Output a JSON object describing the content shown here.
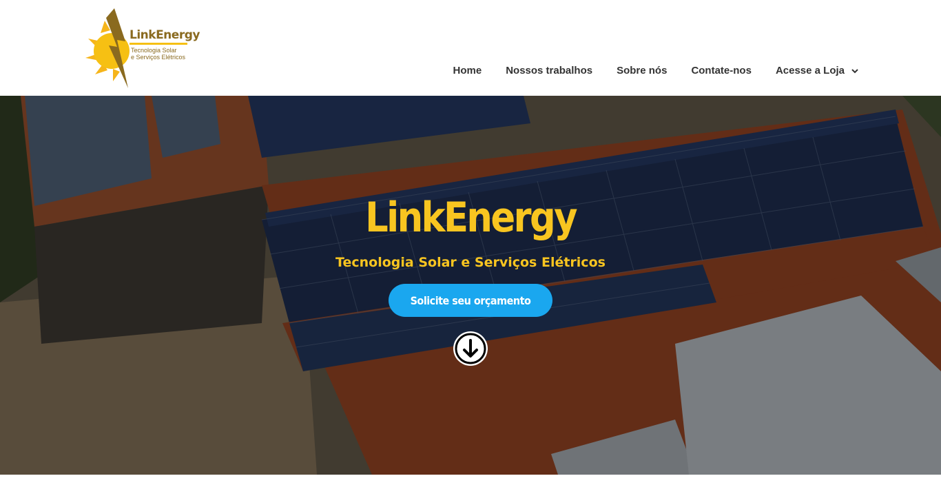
{
  "brand": {
    "name": "LinkEnergy",
    "tagline_line1": "Tecnologia Solar",
    "tagline_line2": "e Serviços Elétricos",
    "icon": "sun-lightning-logo"
  },
  "nav": {
    "items": [
      {
        "label": "Home"
      },
      {
        "label": "Nossos trabalhos"
      },
      {
        "label": "Sobre nós"
      },
      {
        "label": "Contate-nos"
      },
      {
        "label": "Acesse a Loja",
        "icon": "chevron-down-icon"
      }
    ]
  },
  "hero": {
    "title": "LinkEnergy",
    "subtitle": "Tecnologia Solar e Serviços Elétricos",
    "cta_label": "Solicite seu orçamento",
    "scroll_icon": "arrow-down-icon",
    "background": "solar-panels-roof-photo"
  },
  "colors": {
    "accent_yellow": "#f8c520",
    "cta_blue": "#1aa7ef",
    "nav_text": "#333333",
    "logo_brown": "#8a6a1f"
  }
}
